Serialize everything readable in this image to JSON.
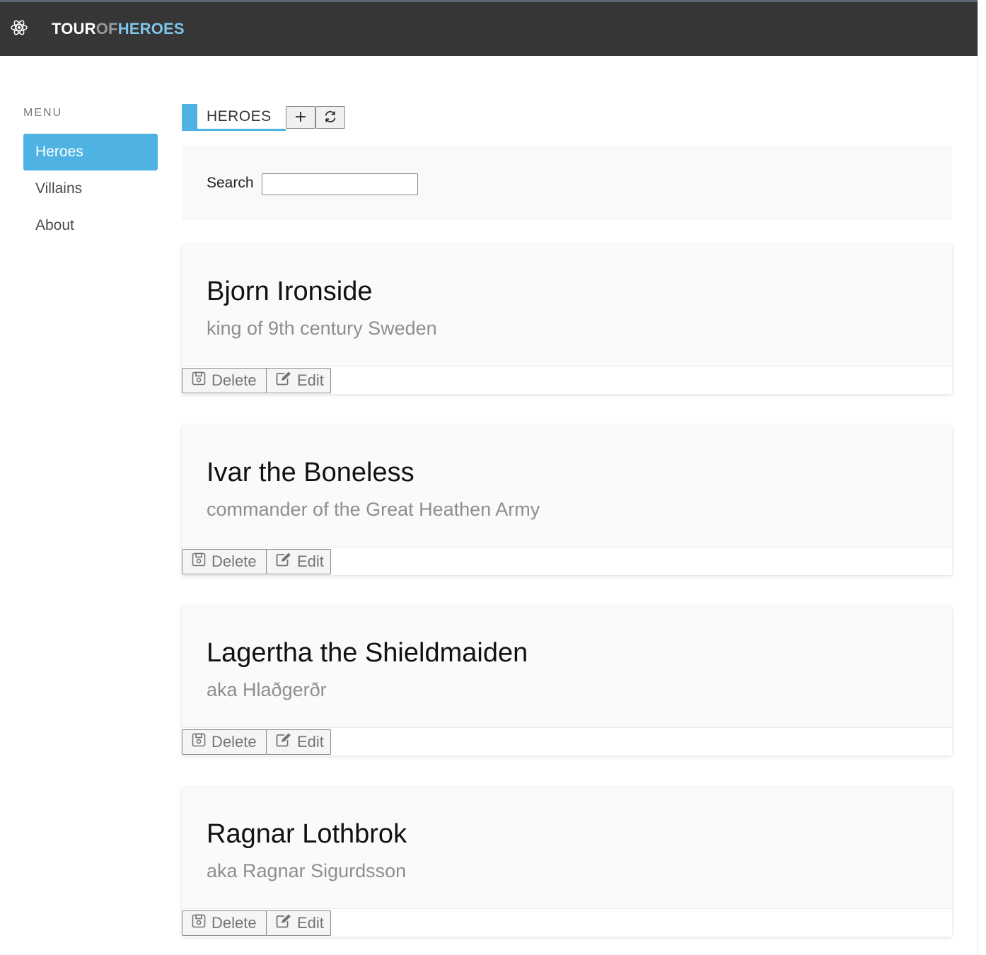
{
  "app": {
    "brand_part1": "TOUR",
    "brand_part2": "OF",
    "brand_part3": "HEROES",
    "brand_icon": "atom-icon"
  },
  "colors": {
    "navbar": "#363636",
    "accent": "#4eb2e2",
    "brand_accent": "#7fc4eb"
  },
  "sidebar": {
    "label": "MENU",
    "items": [
      {
        "label": "Heroes",
        "active": true
      },
      {
        "label": "Villains",
        "active": false
      },
      {
        "label": "About",
        "active": false
      }
    ]
  },
  "main": {
    "title": "HEROES",
    "add_icon": "plus-icon",
    "refresh_icon": "refresh-icon",
    "search": {
      "label": "Search",
      "value": "",
      "placeholder": ""
    }
  },
  "heroes": [
    {
      "name": "Bjorn Ironside",
      "description": "king of 9th century Sweden",
      "delete_label": "Delete",
      "edit_label": "Edit"
    },
    {
      "name": "Ivar the Boneless",
      "description": "commander of the Great Heathen Army",
      "delete_label": "Delete",
      "edit_label": "Edit"
    },
    {
      "name": "Lagertha the Shieldmaiden",
      "description": "aka Hlaðgerðr",
      "delete_label": "Delete",
      "edit_label": "Edit"
    },
    {
      "name": "Ragnar Lothbrok",
      "description": "aka Ragnar Sigurdsson",
      "delete_label": "Delete",
      "edit_label": "Edit"
    }
  ]
}
